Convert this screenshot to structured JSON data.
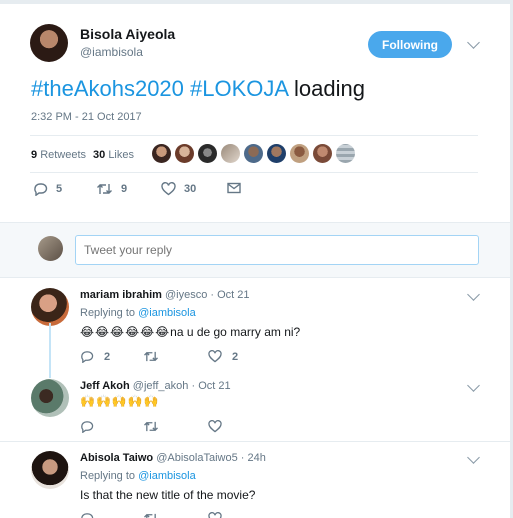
{
  "tweet": {
    "author_name": "Bisola Aiyeola",
    "author_handle": "@iambisola",
    "follow_label": "Following",
    "text_tag1": "#theAkohs2020",
    "text_tag2": "#LOKOJA",
    "text_rest": "loading",
    "timestamp": "2:32 PM - 21 Oct 2017",
    "retweets_count": "9",
    "retweets_label": "Retweets",
    "likes_count": "30",
    "likes_label": "Likes",
    "actions": {
      "reply_count": "5",
      "retweet_count": "9",
      "like_count": "30"
    },
    "icons": [
      "reply-icon",
      "retweet-icon",
      "heart-icon",
      "envelope-icon",
      "chevron-down-icon"
    ],
    "colors": {
      "accent": "#1b95e0",
      "follow_button": "#4aa8ec",
      "text": "#14171a",
      "muted": "#657786"
    }
  },
  "reply_box": {
    "placeholder": "Tweet your reply"
  },
  "replies": [
    {
      "name": "mariam ibrahim",
      "handle": "@iyesco",
      "date": "Oct 21",
      "replying_prefix": "Replying to",
      "replying_to": "@iambisola",
      "emoji": "😂😂😂😂😂😂",
      "text": "na u de go marry am ni?",
      "reply_count": "2",
      "retweet_count": "",
      "like_count": "2"
    },
    {
      "name": "Jeff Akoh",
      "handle": "@jeff_akoh",
      "date": "Oct 21",
      "emoji": "🙌🙌🙌🙌🙌",
      "reply_count": "",
      "retweet_count": "",
      "like_count": ""
    },
    {
      "name": "Abisola Taiwo",
      "handle": "@AbisolaTaiwo5",
      "date": "24h",
      "replying_prefix": "Replying to",
      "replying_to": "@iambisola",
      "text": "Is that the new title of the movie?"
    }
  ]
}
